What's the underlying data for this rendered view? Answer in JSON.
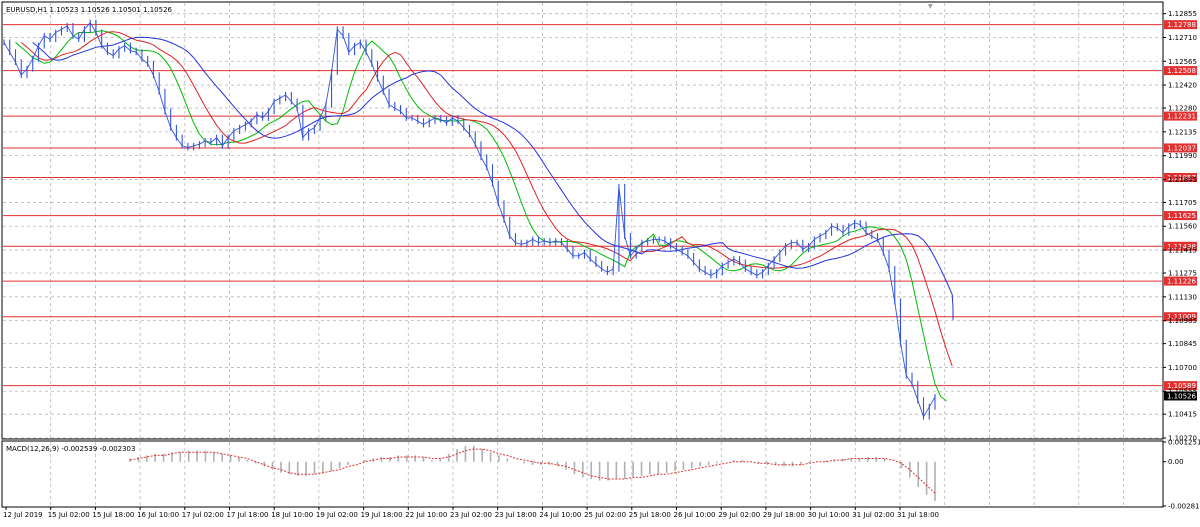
{
  "window": {
    "title": "EURUSD,H1 1.10523 1.10526 1.10501 1.10526",
    "corner_marker": "▼"
  },
  "colors": {
    "background": "#ffffff",
    "grid": "#b8b8b8",
    "price_line": "#3355dd",
    "level_line": "#e23030",
    "ma_fast": "#00bb00",
    "ma_mid": "#dd2222",
    "ma_slow": "#2233dd",
    "macd_hist": "#b0b0b0",
    "macd_signal": "#e23030"
  },
  "chart_data": [
    {
      "type": "line",
      "name": "price",
      "title": "EURUSD,H1",
      "ohlc_header": "1.10523 1.10526 1.10501 1.10526",
      "x_ticks": [
        "12 Jul 2019",
        "15 Jul 02:00",
        "15 Jul 18:00",
        "16 Jul 10:00",
        "17 Jul 02:00",
        "17 Jul 18:00",
        "18 Jul 10:00",
        "19 Jul 02:00",
        "19 Jul 18:00",
        "22 Jul 10:00",
        "23 Jul 02:00",
        "23 Jul 18:00",
        "24 Jul 10:00",
        "25 Jul 02:00",
        "25 Jul 18:00",
        "26 Jul 10:00",
        "29 Jul 02:00",
        "29 Jul 18:00",
        "30 Jul 10:00",
        "31 Jul 02:00",
        "31 Jul 18:00"
      ],
      "y_ticks": [
        "1.12855",
        "1.12710",
        "1.12565",
        "1.12420",
        "1.12280",
        "1.12135",
        "1.11990",
        "1.11845",
        "1.11705",
        "1.11560",
        "1.11415",
        "1.11275",
        "1.11130",
        "1.10985",
        "1.10845",
        "1.10700",
        "1.10555",
        "1.10415",
        "1.10270"
      ],
      "ylim": [
        1.1027,
        1.1292
      ],
      "grid": true,
      "horizontal_levels": [
        "1.12788",
        "1.12508",
        "1.12231",
        "1.12037",
        "1.11857",
        "1.11625",
        "1.11438",
        "1.11226",
        "1.11009",
        "1.10589"
      ],
      "current_price": "1.10526",
      "series": [
        {
          "values": [
            1.1268,
            1.1262,
            1.1256,
            1.1248,
            1.1252,
            1.1258,
            1.1266,
            1.1272,
            1.127,
            1.1274,
            1.1276,
            1.1278,
            1.1272,
            1.127,
            1.1276,
            1.128,
            1.1274,
            1.1266,
            1.1262,
            1.126,
            1.1264,
            1.1266,
            1.1263,
            1.1262,
            1.1258,
            1.1255,
            1.1248,
            1.1238,
            1.1226,
            1.1216,
            1.121,
            1.1205,
            1.1204,
            1.1205,
            1.1206,
            1.1208,
            1.1207,
            1.121,
            1.1205,
            1.121,
            1.1214,
            1.1216,
            1.1218,
            1.122,
            1.1224,
            1.1222,
            1.1226,
            1.1232,
            1.1234,
            1.1236,
            1.1232,
            1.1228,
            1.121,
            1.1214,
            1.1216,
            1.1222,
            1.123,
            1.125,
            1.1276,
            1.1272,
            1.1262,
            1.1266,
            1.1268,
            1.1262,
            1.1255,
            1.1246,
            1.1238,
            1.123,
            1.1228,
            1.1226,
            1.1222,
            1.1222,
            1.122,
            1.1218,
            1.122,
            1.1222,
            1.1221,
            1.1219,
            1.1222,
            1.122,
            1.1216,
            1.1212,
            1.1206,
            1.1198,
            1.1192,
            1.1182,
            1.117,
            1.116,
            1.115,
            1.1146,
            1.1145,
            1.1146,
            1.1148,
            1.1146,
            1.1147,
            1.1146,
            1.1147,
            1.1146,
            1.1142,
            1.1138,
            1.1138,
            1.114,
            1.1136,
            1.1133,
            1.113,
            1.1128,
            1.113,
            1.118,
            1.115,
            1.1138,
            1.1142,
            1.1146,
            1.1147,
            1.1148,
            1.1148,
            1.1147,
            1.1144,
            1.1142,
            1.114,
            1.1138,
            1.1134,
            1.113,
            1.1128,
            1.1126,
            1.1128,
            1.1132,
            1.1134,
            1.1136,
            1.1134,
            1.113,
            1.1128,
            1.1126,
            1.1128,
            1.1132,
            1.1136,
            1.114,
            1.1144,
            1.1146,
            1.1146,
            1.1142,
            1.1144,
            1.1148,
            1.115,
            1.1152,
            1.1156,
            1.1155,
            1.1152,
            1.1156,
            1.1158,
            1.1157,
            1.1152,
            1.115,
            1.1148,
            1.114,
            1.113,
            1.111,
            1.1085,
            1.1065,
            1.106,
            1.105,
            1.104,
            1.1046,
            1.1052
          ]
        }
      ]
    },
    {
      "type": "bar",
      "name": "MACD",
      "title": "MACD(12,26,9) -0.002539 -0.002303",
      "y_ticks": [
        "0.001251",
        "0.00",
        "-0.002814"
      ],
      "ylim": [
        -0.002814,
        0.001251
      ],
      "series": [
        {
          "name": "histogram",
          "values": [
            0.0002,
            0.0003,
            0.0004,
            0.0005,
            0.0005,
            0.0006,
            0.0006,
            0.0007,
            0.0007,
            0.0007,
            0.0006,
            0.0005,
            0.0004,
            0.0003,
            0.0001,
            -0.0001,
            -0.0003,
            -0.0005,
            -0.0007,
            -0.0008,
            -0.0009,
            -0.0009,
            -0.0008,
            -0.0007,
            -0.0006,
            -0.0004,
            -0.0002,
            0.0,
            0.0001,
            0.0002,
            0.0003,
            0.0003,
            0.0004,
            0.0004,
            0.0004,
            0.0003,
            0.0001,
            0.0002,
            0.0005,
            0.0008,
            0.001,
            0.001,
            0.0008,
            0.0006,
            0.0004,
            0.0002,
            0.0,
            -0.0001,
            -0.0002,
            -0.0002,
            -0.0002,
            -0.0003,
            -0.0005,
            -0.0008,
            -0.001,
            -0.0011,
            -0.0012,
            -0.0012,
            -0.0011,
            -0.0011,
            -0.001,
            -0.0009,
            -0.0008,
            -0.0008,
            -0.0007,
            -0.0006,
            -0.0005,
            -0.0004,
            -0.0003,
            -0.0002,
            -0.0001,
            0.0,
            0.0001,
            0.0001,
            0.0,
            -0.0001,
            -0.0002,
            -0.0002,
            -0.0003,
            -0.0003,
            -0.0002,
            -0.0001,
            0.0,
            0.0001,
            0.0001,
            0.0002,
            0.0002,
            0.0002,
            0.0003,
            0.0003,
            0.0002,
            0.0,
            -0.0004,
            -0.001,
            -0.0016,
            -0.0021,
            -0.0025
          ]
        },
        {
          "name": "signal",
          "values": [
            0.0001,
            0.0002,
            0.0003,
            0.0004,
            0.0004,
            0.0005,
            0.0006,
            0.0006,
            0.0006,
            0.0006,
            0.0006,
            0.0005,
            0.0004,
            0.0003,
            0.0002,
            0.0,
            -0.0002,
            -0.0004,
            -0.0005,
            -0.0007,
            -0.0008,
            -0.0008,
            -0.0008,
            -0.0007,
            -0.0006,
            -0.0005,
            -0.0003,
            -0.0002,
            0.0,
            0.0001,
            0.0002,
            0.0002,
            0.0003,
            0.0003,
            0.0003,
            0.0003,
            0.0002,
            0.0002,
            0.0003,
            0.0005,
            0.0007,
            0.0008,
            0.0008,
            0.0007,
            0.0005,
            0.0004,
            0.0002,
            0.0001,
            0.0,
            -0.0001,
            -0.0001,
            -0.0002,
            -0.0003,
            -0.0005,
            -0.0007,
            -0.0009,
            -0.001,
            -0.0011,
            -0.0011,
            -0.0011,
            -0.001,
            -0.001,
            -0.0009,
            -0.0008,
            -0.0008,
            -0.0007,
            -0.0006,
            -0.0005,
            -0.0004,
            -0.0003,
            -0.0002,
            -0.0001,
            0.0,
            0.0,
            0.0,
            -0.0001,
            -0.0001,
            -0.0002,
            -0.0002,
            -0.0002,
            -0.0002,
            -0.0001,
            0.0,
            0.0,
            0.0001,
            0.0001,
            0.0002,
            0.0002,
            0.0002,
            0.0002,
            0.0002,
            0.0001,
            -0.0001,
            -0.0005,
            -0.001,
            -0.0015,
            -0.002
          ]
        }
      ]
    }
  ]
}
